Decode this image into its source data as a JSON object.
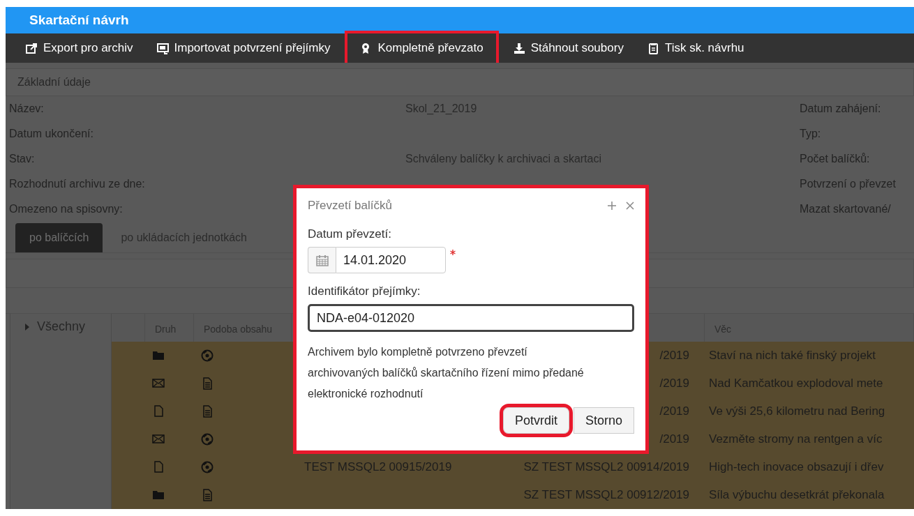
{
  "window": {
    "title": "Skartační návrh"
  },
  "toolbar": [
    {
      "label": "Export pro archiv",
      "kind": "export",
      "highlighted": false
    },
    {
      "label": "Importovat potvrzení přejímky",
      "kind": "import",
      "highlighted": false
    },
    {
      "label": "Kompletně převzato",
      "kind": "award",
      "highlighted": true
    },
    {
      "label": "Stáhnout soubory",
      "kind": "download",
      "highlighted": false
    },
    {
      "label": "Tisk sk. návrhu",
      "kind": "print",
      "highlighted": false
    }
  ],
  "section": {
    "title": "Základní údaje",
    "rows": [
      {
        "label": "Název:",
        "value": "Skol_21_2019",
        "label_2": "Datum zahájení:"
      },
      {
        "label": "Datum ukončení:",
        "label_2": "Typ:"
      },
      {
        "label": "Stav:",
        "value": "Schváleny balíčky k archivaci a skartaci",
        "label_2": "Počet balíčků:"
      },
      {
        "label": "Rozhodnutí archivu ze dne:",
        "label_2": "Potvrzení o převzet"
      },
      {
        "label": "Omezeno na spisovny:",
        "label_2": "Mazat skartované/"
      }
    ]
  },
  "tabs": [
    {
      "label": "po balíčcích",
      "selected": true
    },
    {
      "label": "po ukládacích jednotkách",
      "selected": false
    }
  ],
  "tree": [
    {
      "label": "Všechny",
      "expanded": false
    }
  ],
  "table": {
    "columns": [
      "",
      "Druh",
      "Podoba obsahu",
      "",
      "",
      "Věc"
    ],
    "rows": [
      {
        "icons": [
          {
            "kind": "folder"
          },
          {
            "kind": "disc"
          }
        ],
        "column_5": "/2019",
        "vec": "Staví na nich také finský projekt"
      },
      {
        "icons": [
          {
            "kind": "envelope"
          },
          {
            "kind": "document"
          }
        ],
        "column_5": "/2019",
        "vec": "Nad Kamčatkou explodoval mete"
      },
      {
        "icons": [
          {
            "kind": "page"
          },
          {
            "kind": "document"
          }
        ],
        "column_5": "/2019",
        "vec": "Ve výši 25,6 kilometru nad Bering"
      },
      {
        "icons": [
          {
            "kind": "envelope"
          },
          {
            "kind": "disc"
          }
        ],
        "column_5": "/2019",
        "vec": "Vezměte stromy na rentgen a víc"
      },
      {
        "icons": [
          {
            "kind": "page"
          },
          {
            "kind": "disc"
          }
        ],
        "column_4": "TEST MSSQL2 00915/2019",
        "column_5": "SZ TEST MSSQL2 00914/2019",
        "vec": "High-tech inovace obsazují i dřev"
      },
      {
        "icons": [
          {
            "kind": "folder"
          },
          {
            "kind": "document"
          }
        ],
        "column_5": "SZ TEST MSSQL2 00912/2019",
        "vec": "Síla výbuchu desetkrát překonala"
      }
    ]
  },
  "dialog": {
    "title": "Převzetí balíčků",
    "highlighted": true,
    "date_label": "Datum převzetí:",
    "date_value": "14.01.2020",
    "required": true,
    "id_label": "Identifikátor přejímky:",
    "id_value": "NDA-e04-012020",
    "message": "Archivem bylo kompletně potvrzeno převzetí archivovaných balíčků skartačního řízení mimo předané elektronické rozhodnutí",
    "buttons": [
      {
        "label": "Potvrdit",
        "highlighted": true
      },
      {
        "label": "Storno",
        "highlighted": false
      }
    ]
  }
}
